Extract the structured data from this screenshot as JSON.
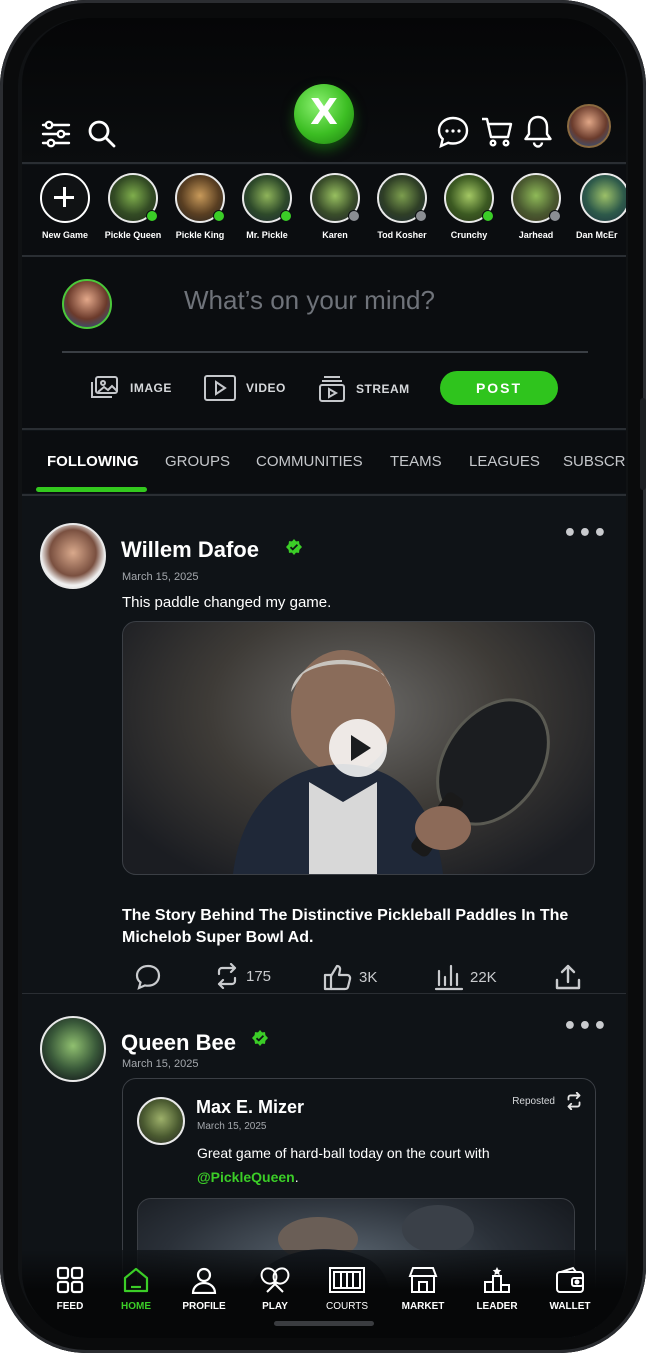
{
  "header": {
    "logo_letter": "X",
    "icons": [
      "filter-sliders-icon",
      "search-icon",
      "chat-icon",
      "cart-icon",
      "bell-icon"
    ]
  },
  "stories": [
    {
      "name": "New Game",
      "type": "new"
    },
    {
      "name": "Pickle Queen",
      "status": "online"
    },
    {
      "name": "Pickle King",
      "status": "online"
    },
    {
      "name": "Mr. Pickle",
      "status": "online"
    },
    {
      "name": "Karen",
      "status": "offline"
    },
    {
      "name": "Tod Kosher",
      "status": "offline"
    },
    {
      "name": "Crunchy",
      "status": "online"
    },
    {
      "name": "Jarhead",
      "status": "offline"
    },
    {
      "name": "Dan McEr",
      "status": "none"
    }
  ],
  "composer": {
    "placeholder": "What’s on your mind?",
    "image_label": "IMAGE",
    "video_label": "VIDEO",
    "stream_label": "STREAM",
    "post_label": "POST"
  },
  "tabs": [
    "FOLLOWING",
    "GROUPS",
    "COMMUNITIES",
    "TEAMS",
    "LEAGUES",
    "SUBSCR"
  ],
  "active_tab": "FOLLOWING",
  "posts": [
    {
      "author": "Willem Dafoe",
      "date": "March 15, 2025",
      "text": "This paddle changed my game.",
      "headline": "The Story Behind The Distinctive Pickleball Paddles In The Michelob Super Bowl Ad.",
      "reposts": "175",
      "likes": "3K",
      "views": "22K"
    },
    {
      "author": "Queen Bee",
      "date": "March 15, 2025",
      "repost": {
        "label": "Reposted",
        "author": "Max E. Mizer",
        "date": "March 15, 2025",
        "text_before": "Great game of hard-ball today on the court with",
        "mention": "@PickleQueen",
        "text_after": "."
      }
    }
  ],
  "bottom_nav": [
    {
      "label": "FEED"
    },
    {
      "label": "HOME"
    },
    {
      "label": "PROFILE"
    },
    {
      "label": "PLAY"
    },
    {
      "label": "COURTS"
    },
    {
      "label": "MARKET"
    },
    {
      "label": "LEADER"
    },
    {
      "label": "WALLET"
    }
  ],
  "active_nav": "HOME",
  "colors": {
    "accent": "#33c81e",
    "background": "#0f1317",
    "online": "#3bcd27",
    "offline": "#8b8e93"
  }
}
